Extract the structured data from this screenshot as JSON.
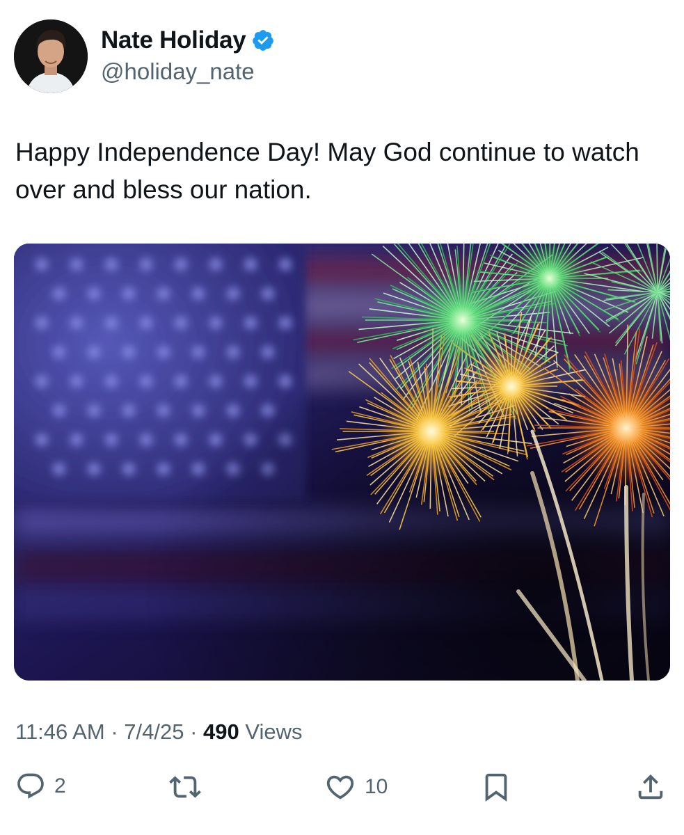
{
  "author": {
    "display_name": "Nate Holiday",
    "handle": "@holiday_nate",
    "verified": true,
    "verified_color": "#1d9bf0"
  },
  "tweet": {
    "text": "Happy Independence Day! May God continue to watch over and bless our nation."
  },
  "media": {
    "description_icon": "fireworks-flag-image"
  },
  "meta": {
    "time": "11:46 AM",
    "separator": "·",
    "date": "7/4/25",
    "views_count": "490",
    "views_label": "Views"
  },
  "actions": {
    "reply": {
      "icon": "reply-icon",
      "count": "2"
    },
    "retweet": {
      "icon": "retweet-icon",
      "count": ""
    },
    "like": {
      "icon": "heart-icon",
      "count": "10"
    },
    "bookmark": {
      "icon": "bookmark-icon"
    },
    "share": {
      "icon": "share-icon"
    }
  },
  "colors": {
    "text_primary": "#0f1419",
    "text_secondary": "#536471",
    "accent": "#1d9bf0"
  }
}
